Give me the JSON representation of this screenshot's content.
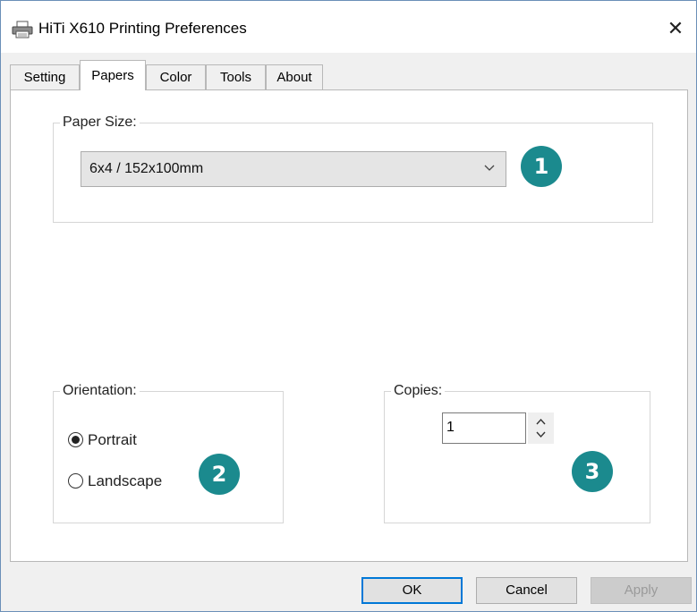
{
  "window": {
    "title": "HiTi X610 Printing Preferences",
    "close_glyph": "✕"
  },
  "tabs": [
    {
      "label": "Setting",
      "active": false
    },
    {
      "label": "Papers",
      "active": true
    },
    {
      "label": "Color",
      "active": false
    },
    {
      "label": "Tools",
      "active": false
    },
    {
      "label": "About",
      "active": false
    }
  ],
  "paper_size": {
    "group_label": "Paper Size:",
    "selected": "6x4 / 152x100mm"
  },
  "orientation": {
    "group_label": "Orientation:",
    "options": [
      {
        "label": "Portrait",
        "selected": true
      },
      {
        "label": "Landscape",
        "selected": false
      }
    ]
  },
  "copies": {
    "group_label": "Copies:",
    "value": "1"
  },
  "callouts": [
    "1",
    "2",
    "3"
  ],
  "buttons": {
    "ok": "OK",
    "cancel": "Cancel",
    "apply": "Apply"
  },
  "colors": {
    "callout": "#1b8a8e",
    "focus": "#0078d7"
  }
}
